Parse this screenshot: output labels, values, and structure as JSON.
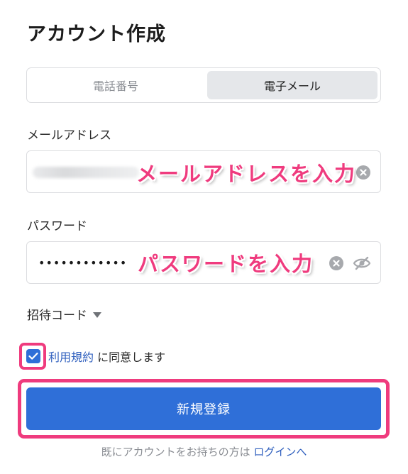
{
  "page": {
    "title": "アカウント作成"
  },
  "tabs": [
    {
      "label": "電話番号",
      "active": false
    },
    {
      "label": "電子メール",
      "active": true
    }
  ],
  "email_field": {
    "label": "メールアドレス",
    "value_obscured": true,
    "overlay_annotation": "メールアドレスを入力"
  },
  "password_field": {
    "label": "パスワード",
    "value": "••••••••••••",
    "overlay_annotation": "パスワードを入力"
  },
  "invite_code": {
    "label": "招待コード"
  },
  "terms": {
    "checked": true,
    "link_text": "利用規約",
    "suffix": " に同意します"
  },
  "submit": {
    "label": "新規登録"
  },
  "footer": {
    "text": "既にアカウントをお持ちの方は ",
    "link": "ログインへ"
  },
  "colors": {
    "primary": "#2f6fd8",
    "annotation": "#ef3b7e",
    "link": "#2f5fbe"
  },
  "icons": [
    "clear-icon",
    "eye-off-icon",
    "caret-down-icon",
    "check-icon"
  ]
}
